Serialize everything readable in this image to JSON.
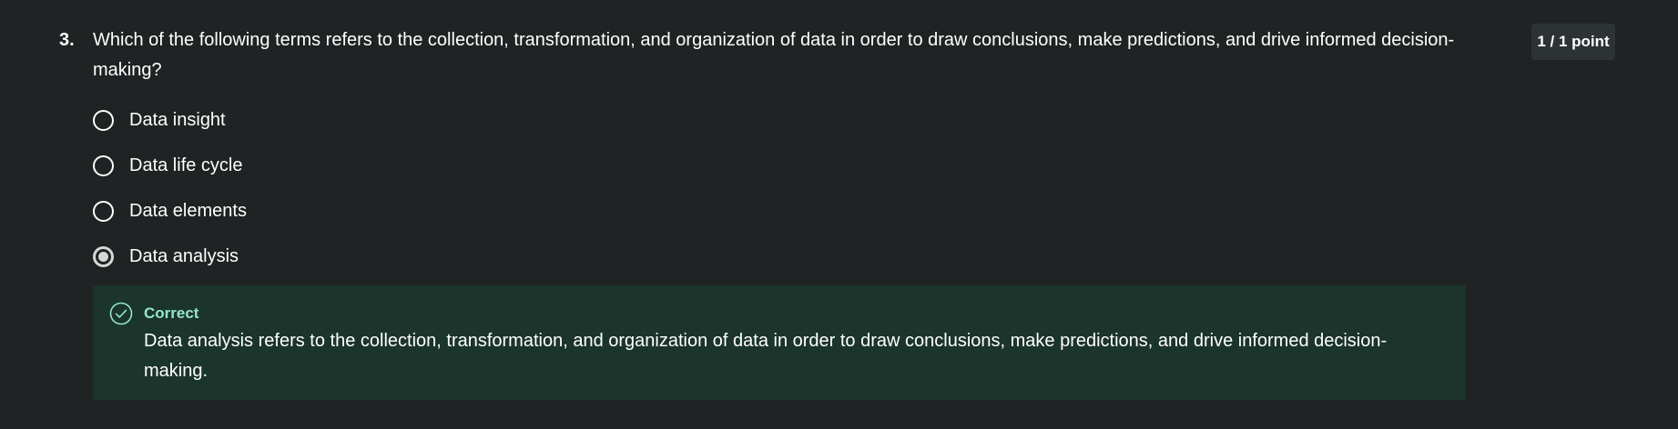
{
  "question": {
    "number": "3.",
    "text": "Which of the following terms refers to the collection, transformation, and organization of data in order to draw conclusions, make predictions, and drive informed decision-making?",
    "score": "1 / 1 point"
  },
  "options": [
    {
      "label": "Data insight",
      "selected": false
    },
    {
      "label": "Data life cycle",
      "selected": false
    },
    {
      "label": "Data elements",
      "selected": false
    },
    {
      "label": "Data analysis",
      "selected": true
    }
  ],
  "feedback": {
    "icon": "check-circle-icon",
    "title": "Correct",
    "text": "Data analysis refers to the collection, transformation, and organization of data in order to draw conclusions, make predictions, and drive informed decision-making.",
    "title_color": "#94e6c8",
    "background_color": "#1b342c"
  },
  "colors": {
    "background": "#1f2324",
    "text": "#ffffff",
    "badge_background": "#2d3334"
  }
}
